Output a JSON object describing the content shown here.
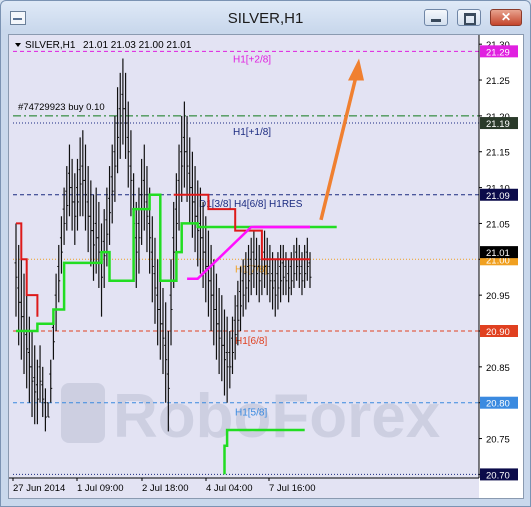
{
  "window": {
    "title": "SILVER,H1",
    "buttons": {
      "minimize": "minimize",
      "maximize": "maximize",
      "close": "close"
    }
  },
  "chart_header": {
    "symbol": "SILVER,H1",
    "ohlc": "21.01 21.03 21.00 21.01",
    "order_label": "#74729923 buy 0.10"
  },
  "watermark": "RoboForex",
  "colors": {
    "background": "#e3e3f3",
    "axis_label_bg": "#0b0b4a",
    "price_label_bg": "#000000",
    "murrey_plus2": "#e020e0",
    "murrey_1_8": "#1a2a80",
    "order_line": "#0f7a1a",
    "murrey_7_8": "#f0a020",
    "murrey_6_8": "#e04020",
    "murrey_5_8": "#3a8ae0",
    "green_line": "#22dd22",
    "red_line": "#dd1a1a",
    "magenta_line": "#ff10ff",
    "arrow": "#f08030",
    "price_bars": "#101010"
  },
  "chart_data": {
    "type": "line",
    "symbol": "SILVER",
    "timeframe": "H1",
    "x_tick_labels": [
      "27 Jun 2014",
      "1 Jul 09:00",
      "2 Jul 18:00",
      "4 Jul 04:00",
      "7 Jul 16:00"
    ],
    "y_tick_labels": [
      "21.30",
      "21.25",
      "21.20",
      "21.15",
      "21.10",
      "21.05",
      "21.00",
      "20.95",
      "20.90",
      "20.85",
      "20.80",
      "20.75",
      "20.70"
    ],
    "ylim": [
      20.7,
      21.3
    ],
    "grid": false,
    "levels": [
      {
        "name": "H1[+2/8]",
        "price": 21.29,
        "price_label": "21.29",
        "style": "dashed",
        "color": "#e020e0"
      },
      {
        "name": "H1[+1/8]",
        "price": 21.19,
        "price_label": "21.19",
        "style": "dotted",
        "color": "#1a2a80"
      },
      {
        "name": "order",
        "price": 21.2,
        "price_label": "",
        "style": "dash-dot",
        "color": "#0f7a1a"
      },
      {
        "name": "D1[3/8] H4[6/8] H1RES",
        "price": 21.09,
        "price_label": "21.09",
        "style": "dashed",
        "color": "#1a2a80"
      },
      {
        "name": "H1[7/8]",
        "price": 21.0,
        "price_label": "21.00",
        "style": "dotted",
        "color": "#f0a020"
      },
      {
        "name": "H1[6/8]",
        "price": 20.9,
        "price_label": "20.90",
        "style": "dashed",
        "color": "#e04020"
      },
      {
        "name": "H1[5/8]",
        "price": 20.8,
        "price_label": "20.80",
        "style": "dashed",
        "color": "#3a8ae0"
      },
      {
        "name": "",
        "price": 20.7,
        "price_label": "20.70",
        "style": "dotted",
        "color": "#1a2a80"
      }
    ],
    "current_price": {
      "price": 21.01,
      "price_label": "21.01"
    },
    "series": [
      {
        "name": "",
        "color": "#22dd22",
        "x": [
          0,
          8,
          8,
          14,
          14,
          18,
          18,
          32,
          32,
          35,
          35,
          44,
          44,
          50,
          50,
          54,
          54,
          60,
          60,
          62,
          62,
          68,
          68,
          73,
          73,
          75,
          75,
          81,
          81,
          89,
          89,
          103,
          103,
          120
        ],
        "y": [
          20.9,
          20.9,
          20.91,
          20.91,
          20.93,
          20.93,
          20.995,
          20.995,
          21.01,
          21.01,
          20.97,
          20.97,
          21.07,
          21.07,
          21.09,
          21.09,
          20.97,
          20.97,
          21.01,
          21.01,
          21.05,
          21.05,
          21.045,
          21.045,
          21.045,
          21.045,
          21.045,
          21.045,
          21.045,
          21.045,
          21.045,
          21.045,
          21.045,
          21.045
        ]
      },
      {
        "name": "",
        "color": "#22dd22",
        "x": [
          78,
          78,
          79,
          79,
          91,
          91,
          108
        ],
        "y": [
          20.7,
          20.74,
          20.74,
          20.762,
          20.762,
          20.762,
          20.762
        ]
      },
      {
        "name": "",
        "color": "#dd1a1a",
        "x": [
          0,
          2,
          2,
          4,
          4,
          8,
          8
        ],
        "y": [
          21.05,
          21.05,
          21.0,
          21.0,
          20.95,
          20.95,
          20.92
        ]
      },
      {
        "name": "",
        "color": "#dd1a1a",
        "x": [
          59,
          68,
          68,
          72,
          72,
          82,
          82,
          92,
          92,
          100,
          100,
          110
        ],
        "y": [
          21.09,
          21.09,
          21.09,
          21.09,
          21.07,
          21.07,
          21.04,
          21.04,
          21.0,
          21.0,
          21.0,
          21.0
        ]
      },
      {
        "name": "",
        "color": "#ff10ff",
        "x": [
          64,
          68,
          88,
          110
        ],
        "y": [
          20.973,
          20.973,
          21.045,
          21.045
        ]
      }
    ],
    "price_bars": {
      "x": [
        0,
        1,
        2,
        3,
        4,
        5,
        6,
        7,
        8,
        9,
        10,
        11,
        12,
        13,
        14,
        15,
        16,
        17,
        18,
        19,
        20,
        21,
        22,
        23,
        24,
        25,
        26,
        27,
        28,
        29,
        30,
        31,
        32,
        33,
        34,
        35,
        36,
        37,
        38,
        39,
        40,
        41,
        42,
        43,
        44,
        45,
        46,
        47,
        48,
        49,
        50,
        51,
        52,
        53,
        54,
        55,
        56,
        57,
        58,
        59,
        60,
        61,
        62,
        63,
        64,
        65,
        66,
        67,
        68,
        69,
        70,
        71,
        72,
        73,
        74,
        75,
        76,
        77,
        78,
        79,
        80,
        81,
        82,
        83,
        84,
        85,
        86,
        87,
        88,
        89,
        90,
        91,
        92,
        93,
        94,
        95,
        96,
        97,
        98,
        99,
        100,
        101,
        102,
        103,
        104,
        105,
        106,
        107,
        108,
        109,
        110
      ],
      "high": [
        21.05,
        21.02,
        21.0,
        20.98,
        20.95,
        20.92,
        20.9,
        20.88,
        20.86,
        20.88,
        20.85,
        20.82,
        20.8,
        20.86,
        20.93,
        20.98,
        21.02,
        21.06,
        21.1,
        21.13,
        21.16,
        21.14,
        21.12,
        21.14,
        21.17,
        21.18,
        21.16,
        21.13,
        21.11,
        21.09,
        21.1,
        21.08,
        21.05,
        21.07,
        21.1,
        21.13,
        21.16,
        21.2,
        21.24,
        21.26,
        21.28,
        21.26,
        21.22,
        21.18,
        21.12,
        21.08,
        21.1,
        21.14,
        21.16,
        21.13,
        21.1,
        21.06,
        21.03,
        21.0,
        20.98,
        20.96,
        20.94,
        20.9,
        21.0,
        21.08,
        21.12,
        21.16,
        21.2,
        21.22,
        21.2,
        21.17,
        21.15,
        21.13,
        21.11,
        21.1,
        21.08,
        21.06,
        21.04,
        21.02,
        21.0,
        20.98,
        20.96,
        20.95,
        20.93,
        20.92,
        20.9,
        20.92,
        20.95,
        20.97,
        20.99,
        21.0,
        21.01,
        21.02,
        21.03,
        21.04,
        21.03,
        21.02,
        21.03,
        21.04,
        21.03,
        21.02,
        21.01,
        21.0,
        21.01,
        21.02,
        21.02,
        21.01,
        21.0,
        21.01,
        21.02,
        21.03,
        21.02,
        21.01,
        21.02,
        21.03,
        21.01
      ],
      "low": [
        20.92,
        20.88,
        20.86,
        20.84,
        20.82,
        20.8,
        20.78,
        20.77,
        20.77,
        20.8,
        20.78,
        20.76,
        20.78,
        20.8,
        20.86,
        20.9,
        20.94,
        20.98,
        21.02,
        21.04,
        21.06,
        21.04,
        21.02,
        21.04,
        21.06,
        21.06,
        21.04,
        21.01,
        20.99,
        20.97,
        20.98,
        20.96,
        20.92,
        20.96,
        20.99,
        21.02,
        21.05,
        21.08,
        21.12,
        21.14,
        21.16,
        21.14,
        21.1,
        21.06,
        21.0,
        20.96,
        20.98,
        21.02,
        21.04,
        21.01,
        20.98,
        20.94,
        20.91,
        20.88,
        20.86,
        20.84,
        20.8,
        20.76,
        20.88,
        20.96,
        21.0,
        21.04,
        21.08,
        21.1,
        21.08,
        21.05,
        21.03,
        21.01,
        20.99,
        20.98,
        20.96,
        20.94,
        20.92,
        20.9,
        20.88,
        20.86,
        20.84,
        20.83,
        20.81,
        20.8,
        20.82,
        20.84,
        20.86,
        20.88,
        20.9,
        20.92,
        20.93,
        20.94,
        20.95,
        20.96,
        20.95,
        20.94,
        20.95,
        20.96,
        20.95,
        20.94,
        20.93,
        20.92,
        20.93,
        20.94,
        20.95,
        20.95,
        20.94,
        20.95,
        20.96,
        20.97,
        20.96,
        20.95,
        20.96,
        20.97,
        20.96
      ]
    },
    "annotations": [
      {
        "text": "H1[+2/8]",
        "price": 21.29
      },
      {
        "text": "H1[+1/8]",
        "price": 21.19
      },
      {
        "text": "D1[3/8] H4[6/8] H1RES",
        "price": 21.09
      },
      {
        "text": "H1[7/8]",
        "price": 21.0
      },
      {
        "text": "H1[6/8]",
        "price": 20.9
      },
      {
        "text": "H1[5/8]",
        "price": 20.8
      }
    ],
    "arrow": {
      "from_price": 21.055,
      "to_price": 21.28,
      "direction": "up"
    }
  }
}
